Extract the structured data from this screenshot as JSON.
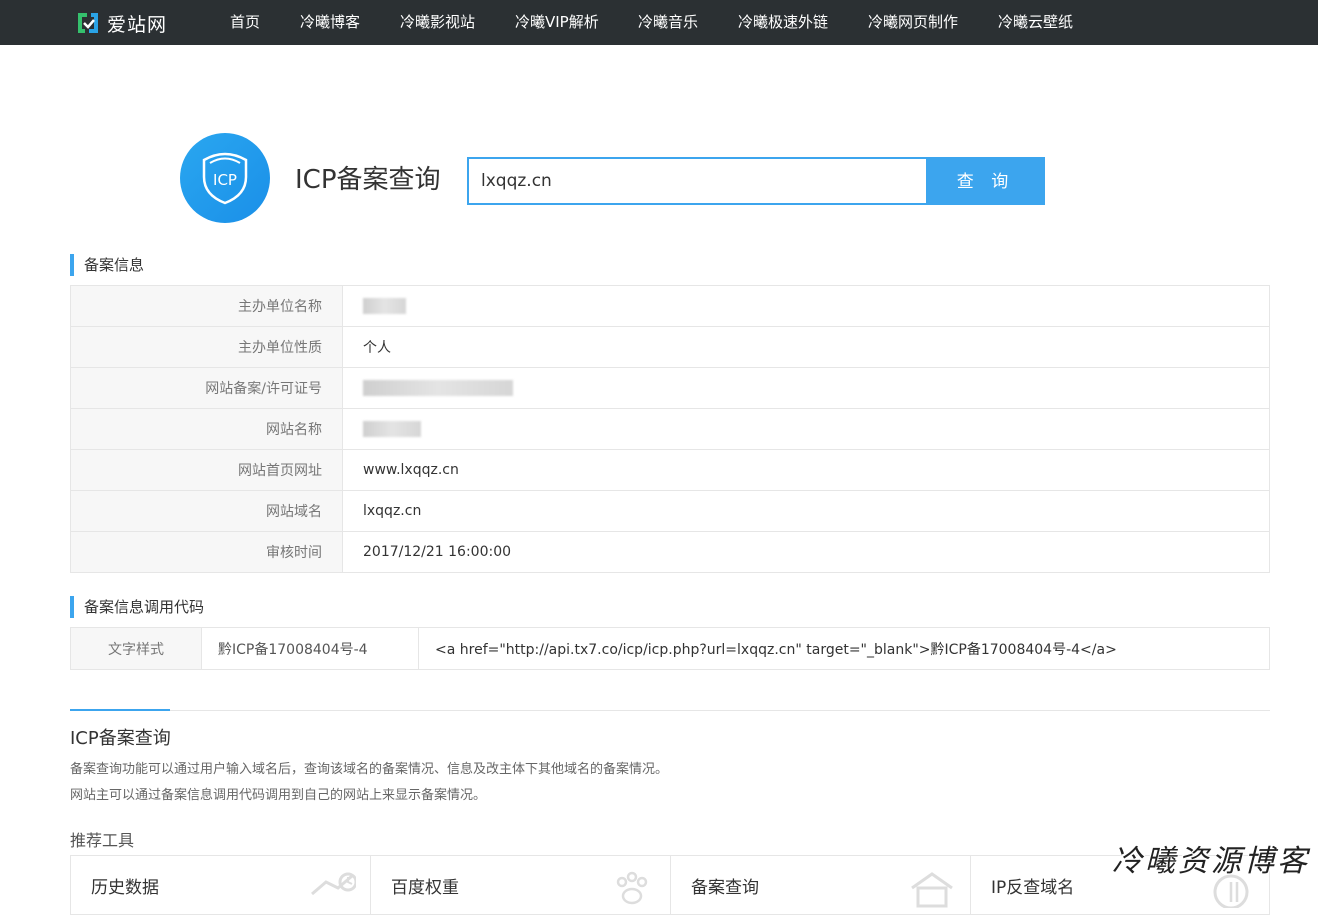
{
  "brand": {
    "name": "爱站网"
  },
  "nav": [
    {
      "label": "首页"
    },
    {
      "label": "冷曦博客"
    },
    {
      "label": "冷曦影视站"
    },
    {
      "label": "冷曦VIP解析"
    },
    {
      "label": "冷曦音乐"
    },
    {
      "label": "冷曦极速外链"
    },
    {
      "label": "冷曦网页制作"
    },
    {
      "label": "冷曦云壁纸"
    }
  ],
  "hero": {
    "badge_text": "ICP",
    "title": "ICP备案查询",
    "search_value": "lxqqz.cn",
    "search_button": "查 询"
  },
  "record_section": {
    "heading": "备案信息",
    "rows": [
      {
        "label": "主办单位名称",
        "value": ""
      },
      {
        "label": "主办单位性质",
        "value": "个人"
      },
      {
        "label": "网站备案/许可证号",
        "value": ""
      },
      {
        "label": "网站名称",
        "value": ""
      },
      {
        "label": "网站首页网址",
        "value": "www.lxqqz.cn"
      },
      {
        "label": "网站域名",
        "value": "lxqqz.cn"
      },
      {
        "label": "审核时间",
        "value": "2017/12/21 16:00:00"
      }
    ]
  },
  "code_section": {
    "heading": "备案信息调用代码",
    "style_label": "文字样式",
    "sample": "黔ICP备17008404号-4",
    "code": "<a href=\"http://api.tx7.co/icp/icp.php?url=lxqqz.cn\" target=\"_blank\">黔ICP备17008404号-4</a>"
  },
  "about": {
    "title": "ICP备案查询",
    "lines": [
      "备案查询功能可以通过用户输入域名后，查询该域名的备案情况、信息及改主体下其他域名的备案情况。",
      "网站主可以通过备案信息调用代码调用到自己的网站上来显示备案情况。"
    ]
  },
  "tools": {
    "title": "推荐工具",
    "cards": [
      {
        "label": "历史数据",
        "icon": "history-icon"
      },
      {
        "label": "百度权重",
        "icon": "paw-icon"
      },
      {
        "label": "备案查询",
        "icon": "house-icon"
      },
      {
        "label": "IP反查域名",
        "icon": "ip-icon"
      }
    ]
  },
  "watermark": "冷曦资源博客",
  "colors": {
    "accent": "#3ca5ee",
    "nav_bg": "#2b3033"
  }
}
